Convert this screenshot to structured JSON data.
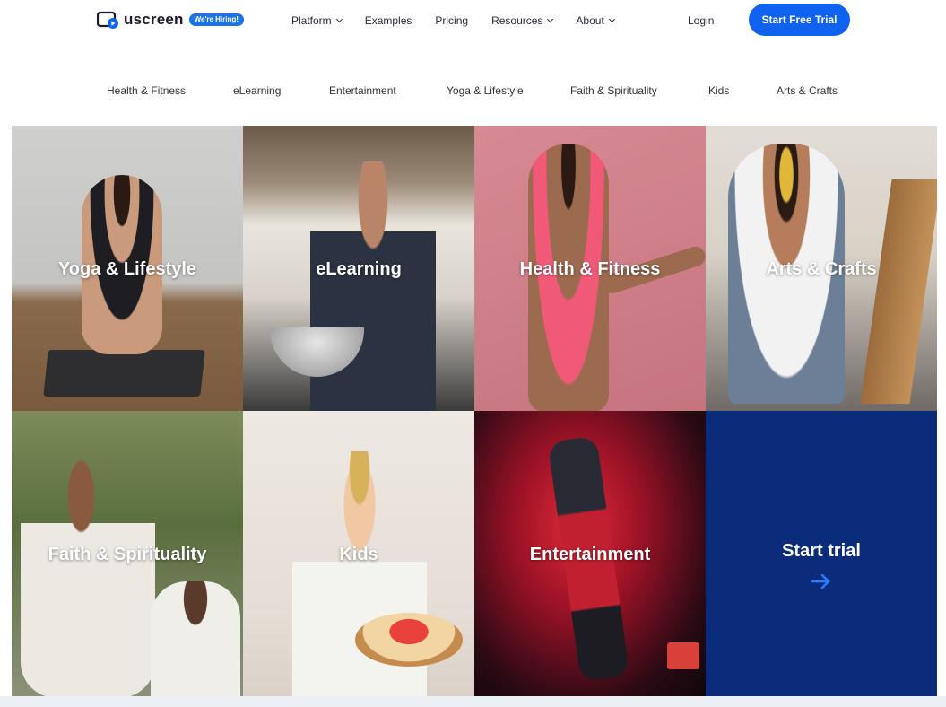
{
  "header": {
    "logo_text": "uscreen",
    "hiring_badge": "We're Hiring!",
    "nav": [
      {
        "label": "Platform",
        "has_dropdown": true
      },
      {
        "label": "Examples",
        "has_dropdown": false
      },
      {
        "label": "Pricing",
        "has_dropdown": false
      },
      {
        "label": "Resources",
        "has_dropdown": true
      },
      {
        "label": "About",
        "has_dropdown": true
      }
    ],
    "login": "Login",
    "cta": "Start Free Trial"
  },
  "category_nav": [
    "Health & Fitness",
    "eLearning",
    "Entertainment",
    "Yoga & Lifestyle",
    "Faith & Spirituality",
    "Kids",
    "Arts & Crafts"
  ],
  "tiles": [
    {
      "label": "Yoga & Lifestyle"
    },
    {
      "label": "eLearning"
    },
    {
      "label": "Health & Fitness"
    },
    {
      "label": "Arts & Crafts"
    },
    {
      "label": "Faith & Spirituality"
    },
    {
      "label": "Kids"
    },
    {
      "label": "Entertainment"
    },
    {
      "label": "Start trial"
    }
  ],
  "colors": {
    "brand_blue": "#1062f0",
    "trial_tile": "#0b2c7a",
    "arrow": "#2b7bff"
  }
}
